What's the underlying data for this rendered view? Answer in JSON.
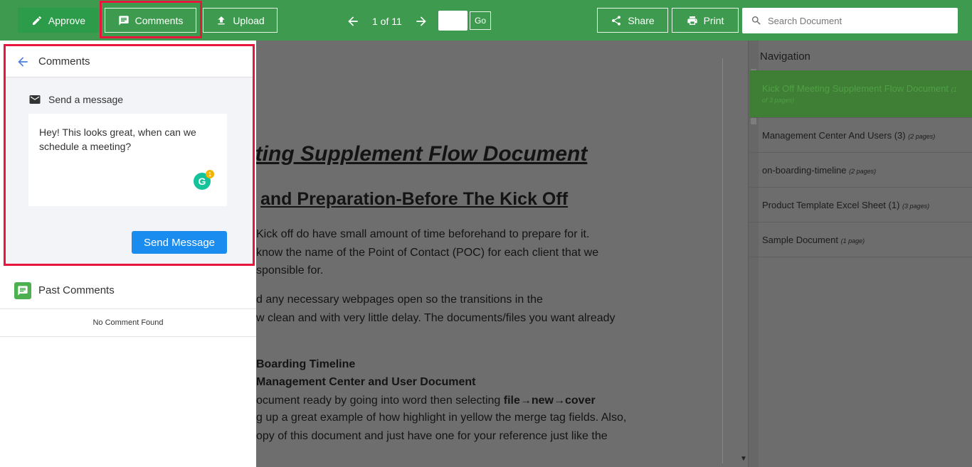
{
  "toolbar": {
    "approve_label": "Approve",
    "comments_label": "Comments",
    "upload_label": "Upload",
    "page_indicator": "1 of 11",
    "go_label": "Go",
    "share_label": "Share",
    "print_label": "Print",
    "search_placeholder": "Search Document"
  },
  "comments_panel": {
    "title": "Comments",
    "send_heading": "Send a message",
    "message_value": "Hey! This looks great, when can we schedule a meeting?",
    "grammarly_letter": "G",
    "grammarly_count": "1",
    "send_button": "Send Message",
    "past_title": "Past Comments",
    "empty_text": "No Comment Found"
  },
  "document": {
    "heading1": "eting Supplement Flow Document",
    "heading2": "and Preparation-Before The Kick Off",
    "lines": [
      "Kick off do have small amount of time beforehand to prepare for it.",
      "know the name of the Point of Contact (POC) for each client that we",
      "sponsible for.",
      "d any necessary webpages open so the transitions in the",
      "w clean and with very little delay. The documents/files you want already"
    ],
    "bold_lines": [
      "Boarding Timeline",
      "Management Center and User Document"
    ],
    "line_file_prefix": "ocument ready by going into word then selecting ",
    "line_file_bold": "file→new→cover",
    "tail_lines": [
      "g up a great example of how highlight in yellow the merge tag fields. Also,",
      "opy of this document and just have one for your reference just like the"
    ]
  },
  "navigation": {
    "title": "Navigation",
    "items": [
      {
        "label": "Kick Off Meeting Supplement Flow Document",
        "pages": "(1 of 3 pages)",
        "active": true
      },
      {
        "label": "Management Center And Users (3)",
        "pages": "(2 pages)",
        "active": false
      },
      {
        "label": "on-boarding-timeline",
        "pages": "(2 pages)",
        "active": false
      },
      {
        "label": "Product Template Excel Sheet (1)",
        "pages": "(3 pages)",
        "active": false
      },
      {
        "label": "Sample Document",
        "pages": "(1 page)",
        "active": false
      }
    ]
  },
  "colors": {
    "toolbar_green": "#3d9a4f",
    "highlight_red": "#e8163c",
    "send_blue": "#1a8cf0"
  }
}
